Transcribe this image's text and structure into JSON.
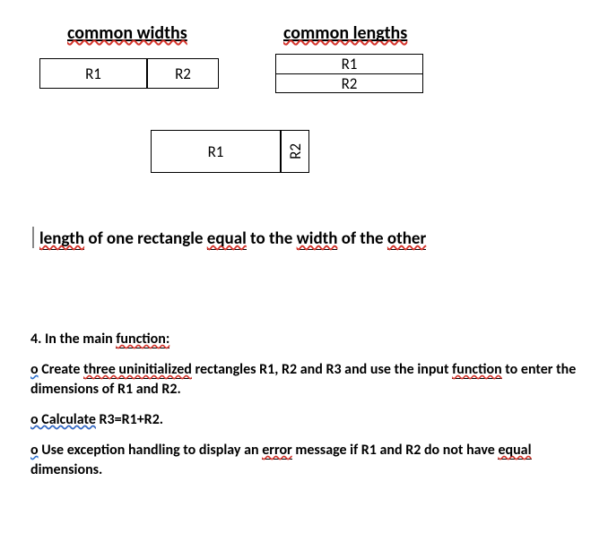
{
  "headings": {
    "common_widths": "common widths",
    "common_lengths": "common lengths"
  },
  "diagram": {
    "top_left_r1": "R1",
    "top_left_r2": "R2",
    "top_right_r1": "R1",
    "top_right_r2": "R2",
    "bottom_r1": "R1",
    "bottom_r2": "R2"
  },
  "caption": {
    "w1": "length",
    "t1": " of one rectangle ",
    "w2": "equal",
    "t2": " to the ",
    "w3": "width",
    "t3": " of the ",
    "w4": "other"
  },
  "section4": {
    "lead_num": "4. In the main ",
    "lead_fn": "function:",
    "a_o": "o",
    "a_1": " Create ",
    "a_2": "three uninitialized",
    "a_3": " rectangles R1, R2 and R3 and use the input ",
    "a_4": "function",
    "a_5": " to enter the dimensions of R1 and R2.",
    "b_o": "o Calculate",
    "b_1": " R3=R1+R2.",
    "c_o": "o",
    "c_1": " Use exception handling to display an ",
    "c_2": "error",
    "c_3": " message if R1 and R2 do not have ",
    "c_4": "equal",
    "c_5": " dimensions."
  }
}
